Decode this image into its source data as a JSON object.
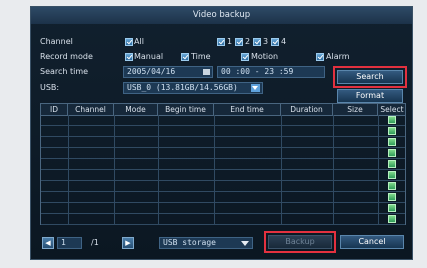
{
  "dialog": {
    "title": "Video backup"
  },
  "channel": {
    "label": "Channel",
    "all": "All",
    "channels": [
      "1",
      "2",
      "3",
      "4"
    ]
  },
  "record_mode": {
    "label": "Record mode",
    "modes": [
      "Manual",
      "Time",
      "Motion",
      "Alarm"
    ]
  },
  "search_time": {
    "label": "Search time",
    "date": "2005/04/16",
    "start": "00 :00",
    "sep": "-",
    "end": "23 :59"
  },
  "usb": {
    "label": "USB:",
    "device": "USB_0 (13.81GB/14.56GB)"
  },
  "buttons": {
    "search": "Search",
    "format": "Format",
    "backup": "Backup",
    "cancel": "Cancel"
  },
  "table": {
    "columns": [
      "ID",
      "Channel",
      "Mode",
      "Begin time",
      "End time",
      "Duration",
      "Size",
      "Select"
    ],
    "row_count": 10
  },
  "pager": {
    "current": "1",
    "total": "/1"
  },
  "storage": {
    "selected": "USB storage"
  }
}
